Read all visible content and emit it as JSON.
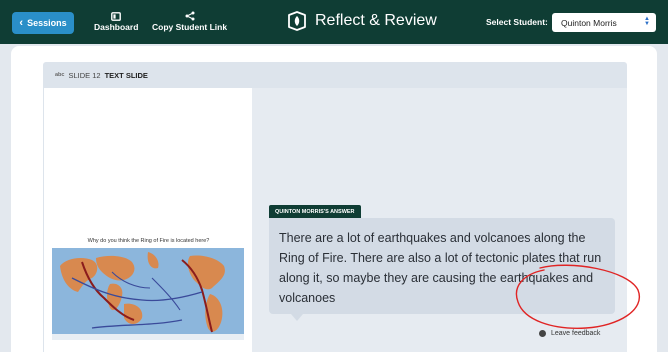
{
  "topbar": {
    "back_label": "Sessions",
    "dashboard_label": "Dashboard",
    "copy_link_label": "Copy Student Link",
    "brand_title": "Reflect & Review",
    "select_label": "Select Student:",
    "selected_student": "Quinton Morris"
  },
  "slide": {
    "tag": "abc",
    "number": "SLIDE 12",
    "type": "TEXT SLIDE",
    "question": "Why do you think the Ring of Fire is located here?"
  },
  "answer": {
    "owner_label": "QUINTON MORRIS'S ANSWER",
    "text": "There are a lot of earthquakes and volcanoes along the Ring of Fire. There are also a lot of tectonic plates that run along it, so maybe they are causing the earthquakes and volcanoes"
  },
  "feedback": {
    "label": "Leave feedback"
  },
  "colors": {
    "header_bg": "#0f3d34",
    "button_blue": "#2a8fc8",
    "answer_bg": "#d3dbe5",
    "panel_bg": "#e6ebf1",
    "annotation_red": "#e02424"
  }
}
